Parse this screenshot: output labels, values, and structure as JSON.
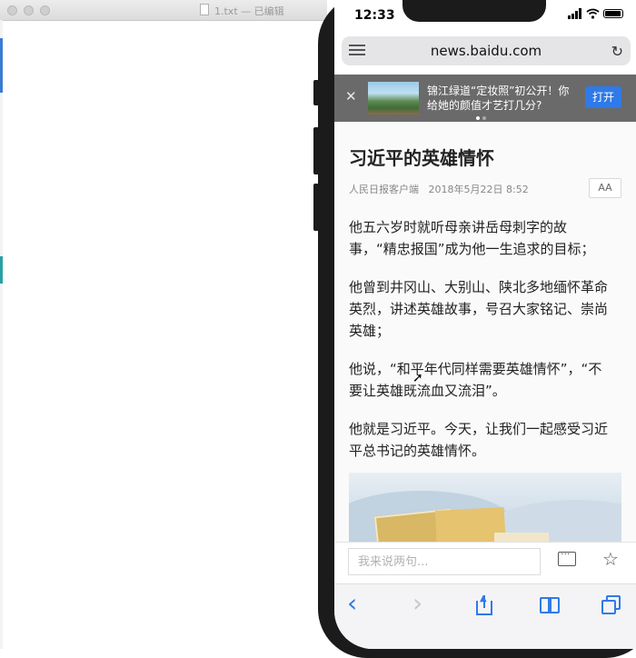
{
  "editor": {
    "title": "1.txt — 已编辑"
  },
  "status": {
    "time": "12:33"
  },
  "browser": {
    "url": "news.baidu.com",
    "reload_icon": "reload-icon",
    "menu_icon": "reader-menu-icon"
  },
  "banner": {
    "close": "✕",
    "text": "锦江绿道“定妆照”初公开！你给她的颜值才艺打几分?",
    "button": "打开"
  },
  "article": {
    "title": "习近平的英雄情怀",
    "source": "人民日报客户端",
    "date": "2018年5月22日 8:52",
    "font_button": "AA",
    "paragraphs": [
      "他五六岁时就听母亲讲岳母刺字的故事，“精忠报国”成为他一生追求的目标；",
      "他曾到井冈山、大别山、陕北多地缅怀革命英烈，讲述英雄故事，号召大家铭记、崇尚英雄；",
      "他说，“和平年代同样需要英雄情怀”，“不要让英雄既流血又流泪”。",
      "他就是习近平。今天，让我们一起感受习近平总书记的英雄情怀。"
    ]
  },
  "comment": {
    "placeholder": "我来说两句..."
  },
  "toolbar": {
    "back": "‹",
    "forward": "›"
  },
  "colors": {
    "accent": "#2f7ae8",
    "banner_bg": "#6a6a6a"
  }
}
